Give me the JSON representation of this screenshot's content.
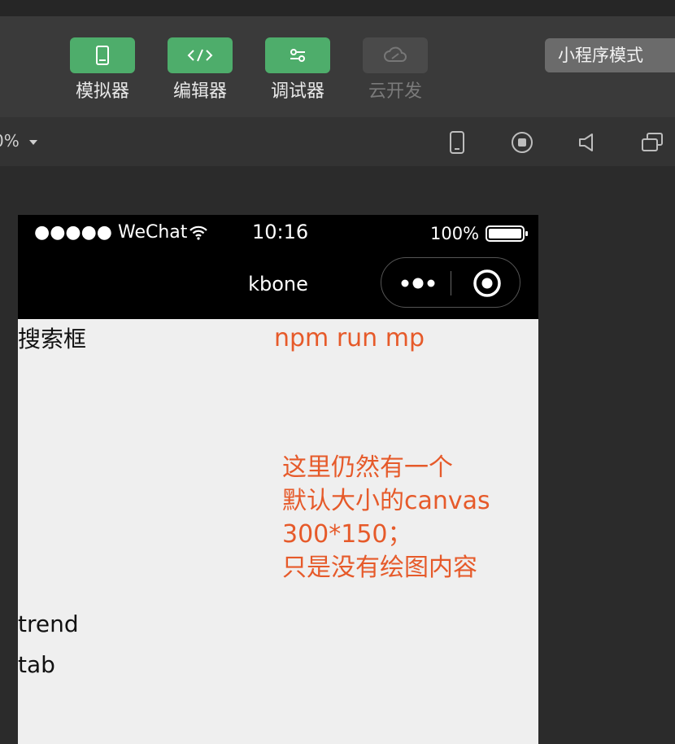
{
  "toolbar": {
    "tools": [
      {
        "label": "模拟器",
        "icon": "phone-icon",
        "enabled": true
      },
      {
        "label": "编辑器",
        "icon": "code-icon",
        "enabled": true
      },
      {
        "label": "调试器",
        "icon": "sliders-icon",
        "enabled": true
      },
      {
        "label": "云开发",
        "icon": "cloud-icon",
        "enabled": false
      }
    ],
    "mode_label": "小程序模式"
  },
  "subbar": {
    "zoom_label": "0%",
    "icons": [
      "phone-icon",
      "record-icon",
      "volume-icon",
      "window-icon"
    ]
  },
  "phone": {
    "status": {
      "carrier": "●●●●● WeChat",
      "time": "10:16",
      "battery": "100%"
    },
    "nav_title": "kbone",
    "content": {
      "search_label": "搜索框",
      "annotation_top": "npm run mp",
      "annotation_lines": [
        "这里仍然有一个",
        "默认大小的canvas",
        "300*150；",
        "只是没有绘图内容"
      ],
      "trend_label": "trend",
      "tab_label": "tab"
    }
  },
  "colors": {
    "accent_green": "#4ead6b",
    "annotation": "#e65a2a",
    "phone_bg": "#efefef",
    "toolbar_bg": "#3a3a3a"
  }
}
